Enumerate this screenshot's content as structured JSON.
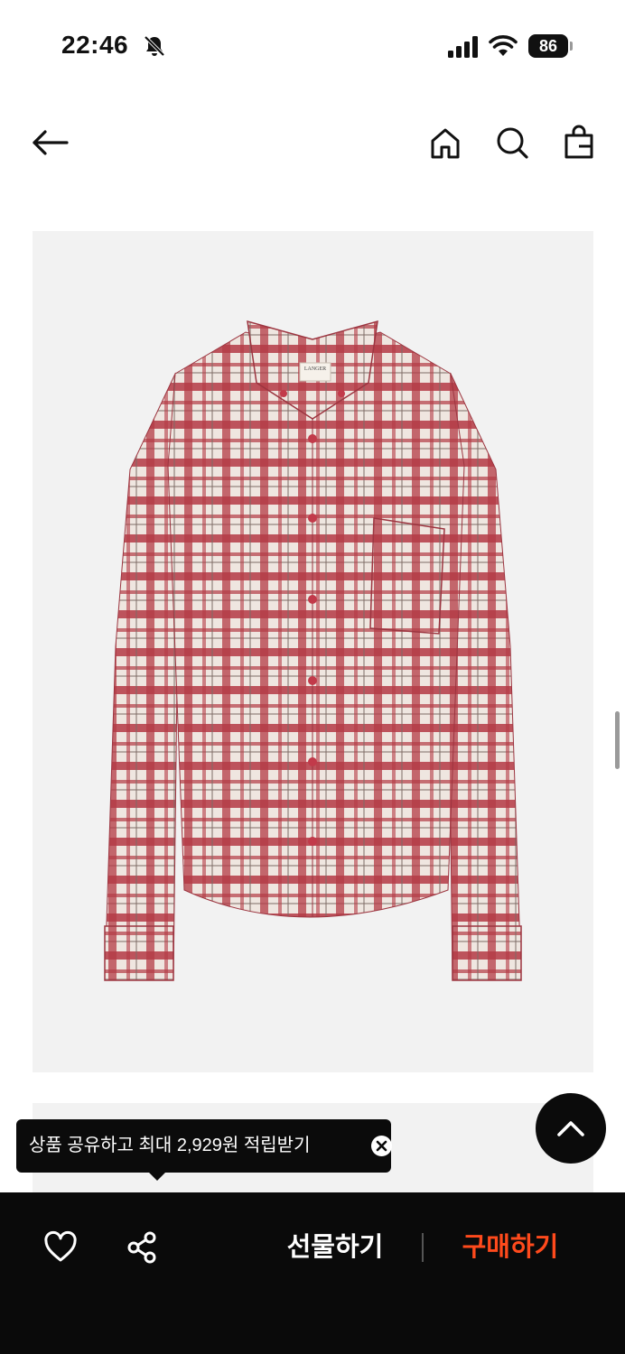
{
  "status_bar": {
    "time": "22:46",
    "battery_level": "86",
    "icons": [
      "bell-off-icon",
      "signal-icon",
      "wifi-icon",
      "battery-icon"
    ]
  },
  "header": {
    "icons": [
      "back-arrow-icon",
      "home-icon",
      "search-icon",
      "shopping-bag-icon"
    ]
  },
  "product": {
    "image": "red-plaid-shirt",
    "brand_label": "LANGER",
    "colors": {
      "plaid_red": "#b43a45",
      "plaid_cream": "#efe6e0",
      "image_bg": "#f2f2f2"
    }
  },
  "tooltip": {
    "text": "상품 공유하고 최대 2,929원 적립받기",
    "close_icon": "close-icon"
  },
  "bottom_bar": {
    "like_icon": "heart-icon",
    "share_icon": "share-icon",
    "gift_label": "선물하기",
    "buy_label": "구매하기",
    "buy_color": "#ff4a1c"
  },
  "scroll_top_icon": "chevron-up-icon"
}
